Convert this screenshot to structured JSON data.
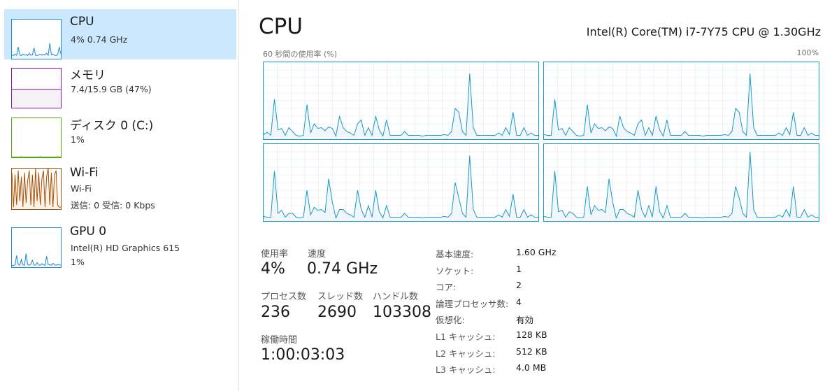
{
  "sidebar": {
    "items": [
      {
        "name": "CPU",
        "sub1": "4%  0.74 GHz",
        "sub2": "",
        "color": "#1f8ad2",
        "fill": "#f1f6fb",
        "selected": true,
        "series": [
          10,
          8,
          12,
          9,
          30,
          10,
          8,
          12,
          9,
          11,
          8,
          14,
          9,
          10,
          28,
          9,
          8,
          10,
          12,
          9,
          11,
          10,
          14,
          9,
          40,
          10,
          12,
          9,
          8,
          11,
          30,
          12
        ]
      },
      {
        "name": "メモリ",
        "sub1": "7.4/15.9 GB (47%)",
        "sub2": "",
        "color": "#8b12ae",
        "fill": "#f4f2f4",
        "selected": false,
        "series": [
          47,
          47,
          47,
          47,
          47,
          47,
          47,
          47,
          47,
          47,
          47,
          47,
          47,
          47,
          47,
          47,
          47,
          47,
          47,
          47,
          47,
          47,
          47,
          47,
          47,
          47,
          47,
          47,
          47,
          47,
          47,
          47
        ]
      },
      {
        "name": "ディスク 0 (C:)",
        "sub1": "1%",
        "sub2": "",
        "color": "#4da60c",
        "fill": "#ffffff",
        "selected": false,
        "series": [
          1,
          1,
          1,
          1,
          1,
          1,
          2,
          1,
          1,
          1,
          1,
          1,
          1,
          1,
          1,
          1,
          1,
          1,
          2,
          1,
          1,
          1,
          1,
          1,
          1,
          1,
          1,
          1,
          1,
          2,
          1,
          1
        ]
      },
      {
        "name": "Wi-Fi",
        "sub1": "Wi-Fi",
        "sub2": "送信: 0 受信: 0 Kbps",
        "color": "#a74f01",
        "fill": "#fcf3eb",
        "selected": false,
        "series": [
          90,
          5,
          85,
          10,
          95,
          20,
          80,
          5,
          90,
          15,
          70,
          95,
          10,
          85,
          5,
          100,
          20,
          90,
          10,
          75,
          95,
          5,
          80,
          100,
          10,
          90,
          5,
          85,
          95,
          10,
          5,
          5
        ]
      },
      {
        "name": "GPU 0",
        "sub1": "Intel(R) HD Graphics 615",
        "sub2": "1%",
        "color": "#1f8ad2",
        "fill": "#f1f6fb",
        "selected": false,
        "series": [
          5,
          4,
          6,
          30,
          8,
          5,
          20,
          6,
          5,
          35,
          7,
          5,
          8,
          18,
          6,
          5,
          12,
          6,
          5,
          9,
          6,
          5,
          28,
          7,
          6,
          5,
          10,
          6,
          5,
          7,
          6,
          5
        ]
      }
    ]
  },
  "main": {
    "title": "CPU",
    "model": "Intel(R) Core(TM) i7-7Y75 CPU @ 1.30GHz",
    "graph_caption": "60 秒間の使用率 (%)",
    "graph_max": "100%",
    "graph_color": "#1999c8",
    "graph_fill": "#f1f6fb",
    "graph_grid": "#d9eaf4",
    "cores": [
      [
        6,
        9,
        5,
        52,
        12,
        14,
        5,
        15,
        10,
        5,
        4,
        5,
        45,
        8,
        20,
        14,
        15,
        11,
        16,
        14,
        4,
        30,
        15,
        10,
        8,
        5,
        20,
        25,
        5,
        15,
        5,
        30,
        12,
        4,
        25,
        5,
        5,
        5,
        5,
        10,
        5,
        5,
        5,
        5,
        4,
        5,
        5,
        5,
        5,
        5,
        6,
        5,
        10,
        40,
        35,
        10,
        5,
        85,
        15,
        5,
        5,
        5,
        5,
        5,
        5,
        8,
        5,
        15,
        6,
        35,
        5,
        5,
        15,
        5,
        8,
        5,
        5
      ],
      [
        6,
        5,
        5,
        52,
        12,
        14,
        5,
        15,
        10,
        5,
        4,
        5,
        45,
        8,
        20,
        14,
        15,
        11,
        16,
        14,
        4,
        30,
        15,
        10,
        8,
        5,
        20,
        25,
        5,
        15,
        5,
        30,
        12,
        4,
        25,
        5,
        5,
        5,
        5,
        10,
        5,
        5,
        5,
        5,
        4,
        5,
        5,
        5,
        5,
        5,
        6,
        5,
        10,
        40,
        35,
        10,
        5,
        85,
        15,
        5,
        5,
        5,
        5,
        5,
        5,
        8,
        5,
        15,
        6,
        35,
        5,
        5,
        15,
        5,
        8,
        5,
        5
      ],
      [
        6,
        5,
        5,
        65,
        10,
        14,
        5,
        10,
        10,
        5,
        4,
        5,
        40,
        8,
        18,
        14,
        15,
        11,
        55,
        25,
        4,
        15,
        15,
        10,
        8,
        5,
        40,
        15,
        5,
        20,
        5,
        40,
        12,
        4,
        20,
        5,
        5,
        5,
        5,
        10,
        5,
        5,
        5,
        5,
        4,
        5,
        5,
        5,
        5,
        5,
        6,
        5,
        10,
        50,
        30,
        10,
        5,
        85,
        15,
        5,
        5,
        5,
        5,
        5,
        5,
        8,
        5,
        15,
        6,
        35,
        5,
        5,
        15,
        5,
        8,
        5,
        5
      ],
      [
        6,
        5,
        5,
        65,
        12,
        14,
        5,
        12,
        10,
        5,
        4,
        5,
        45,
        8,
        20,
        14,
        15,
        11,
        55,
        25,
        4,
        15,
        15,
        10,
        8,
        5,
        40,
        15,
        5,
        20,
        5,
        45,
        12,
        4,
        20,
        5,
        5,
        5,
        5,
        10,
        5,
        5,
        5,
        5,
        4,
        5,
        5,
        5,
        5,
        5,
        6,
        5,
        10,
        45,
        30,
        10,
        5,
        90,
        15,
        5,
        5,
        5,
        5,
        5,
        5,
        8,
        5,
        15,
        6,
        45,
        5,
        5,
        15,
        5,
        8,
        5,
        5
      ]
    ],
    "stats": {
      "usage_label": "使用率",
      "usage_value": "4%",
      "speed_label": "速度",
      "speed_value": "0.74 GHz",
      "proc_label": "プロセス数",
      "proc_value": "236",
      "thread_label": "スレッド数",
      "thread_value": "2690",
      "handle_label": "ハンドル数",
      "handle_value": "103308",
      "uptime_label": "稼働時間",
      "uptime_value": "1:00:03:03"
    },
    "specs": [
      {
        "label": "基本速度:",
        "value": "1.60 GHz"
      },
      {
        "label": "ソケット:",
        "value": "1"
      },
      {
        "label": "コア:",
        "value": "2"
      },
      {
        "label": "論理プロセッサ数:",
        "value": "4"
      },
      {
        "label": "仮想化:",
        "value": "有効"
      },
      {
        "label": "L1 キャッシュ:",
        "value": "128 KB"
      },
      {
        "label": "L2 キャッシュ:",
        "value": "512 KB"
      },
      {
        "label": "L3 キャッシュ:",
        "value": "4.0 MB"
      }
    ]
  }
}
